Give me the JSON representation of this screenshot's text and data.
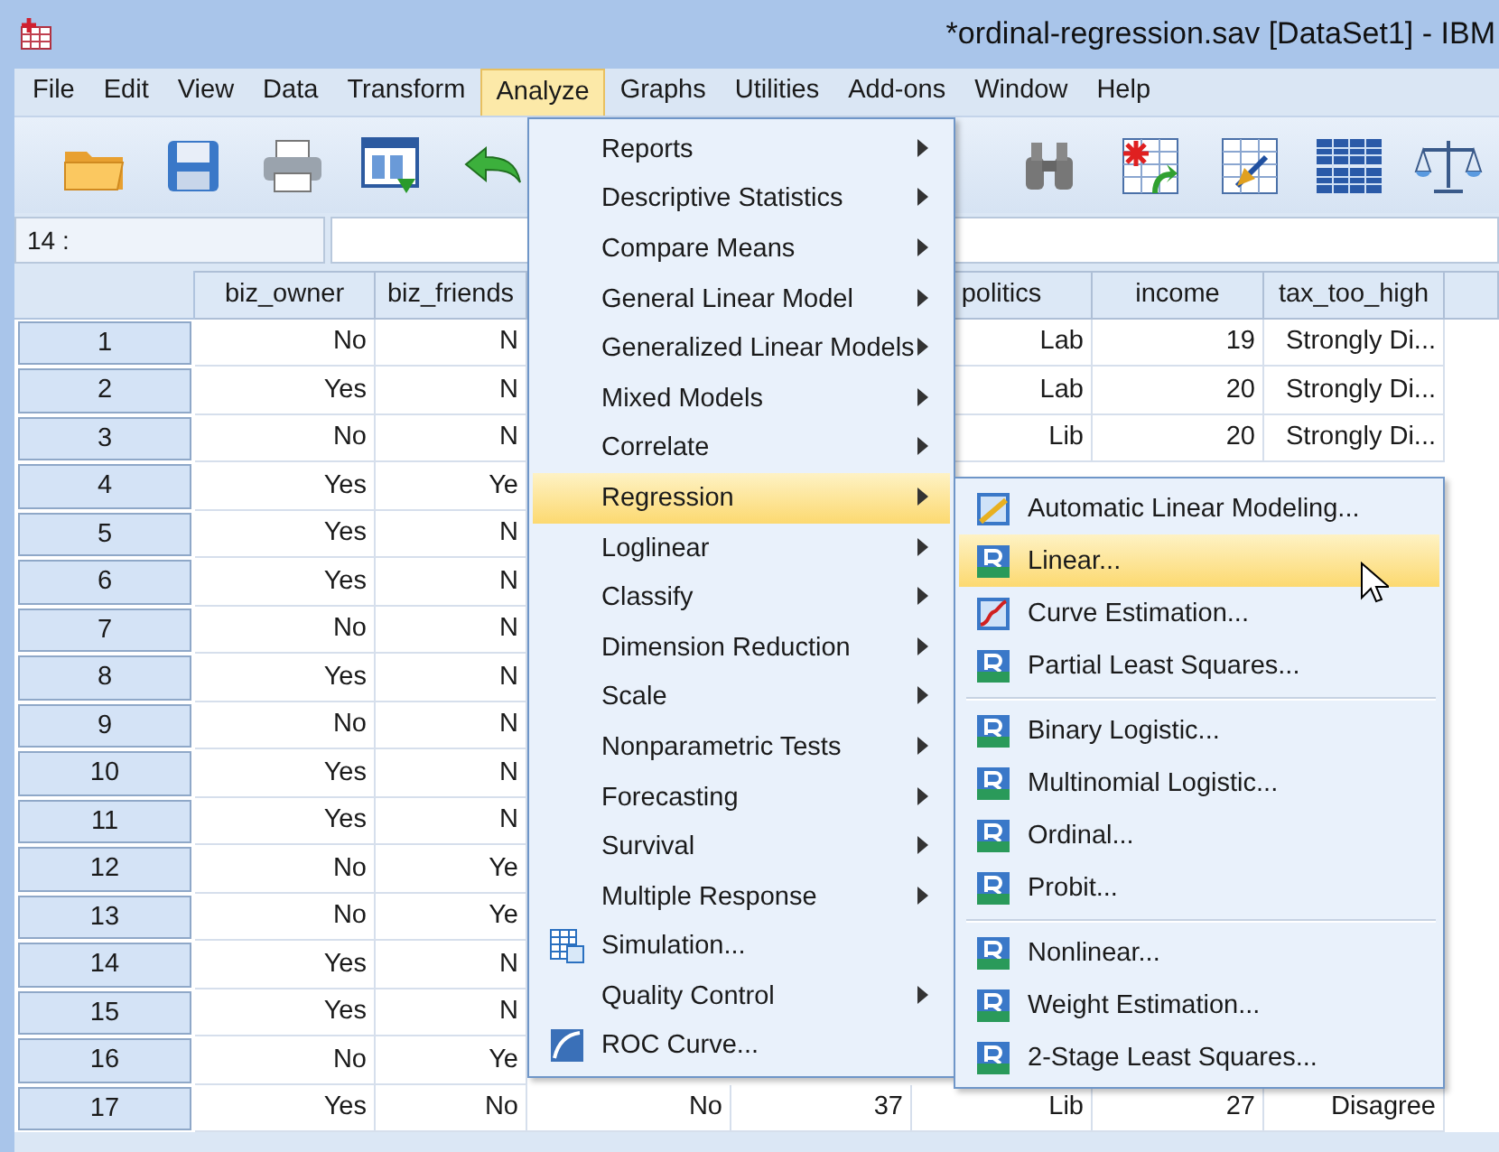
{
  "window": {
    "title": "*ordinal-regression.sav [DataSet1] - IBM"
  },
  "menu_bar": [
    {
      "label": "File",
      "selected": false
    },
    {
      "label": "Edit",
      "selected": false
    },
    {
      "label": "View",
      "selected": false
    },
    {
      "label": "Data",
      "selected": false
    },
    {
      "label": "Transform",
      "selected": false
    },
    {
      "label": "Analyze",
      "selected": true
    },
    {
      "label": "Graphs",
      "selected": false
    },
    {
      "label": "Utilities",
      "selected": false
    },
    {
      "label": "Add-ons",
      "selected": false
    },
    {
      "label": "Window",
      "selected": false
    },
    {
      "label": "Help",
      "selected": false
    }
  ],
  "toolbar": [
    {
      "kind": "folder"
    },
    {
      "kind": "save"
    },
    {
      "kind": "print"
    },
    {
      "kind": "recall"
    },
    {
      "kind": "undo"
    },
    {
      "kind": "gap"
    },
    {
      "kind": "find"
    },
    {
      "kind": "cases"
    },
    {
      "kind": "variable"
    },
    {
      "kind": "split"
    },
    {
      "kind": "weight"
    }
  ],
  "cell_reference": {
    "name": "14 :"
  },
  "grid": {
    "columns": [
      "biz_owner",
      "biz_friends",
      null,
      null,
      "politics",
      "income",
      "tax_too_high",
      null
    ],
    "rows": [
      {
        "number": "1",
        "cells": [
          "No",
          "N",
          null,
          null,
          "Lab",
          "19",
          "Strongly Di...",
          null
        ]
      },
      {
        "number": "2",
        "cells": [
          "Yes",
          "N",
          null,
          null,
          "Lab",
          "20",
          "Strongly Di...",
          null
        ]
      },
      {
        "number": "3",
        "cells": [
          "No",
          "N",
          null,
          null,
          "Lib",
          "20",
          "Strongly Di...",
          null
        ]
      },
      {
        "number": "4",
        "cells": [
          "Yes",
          "Ye",
          null,
          null,
          null,
          null,
          null,
          null
        ]
      },
      {
        "number": "5",
        "cells": [
          "Yes",
          "N",
          null,
          null,
          null,
          null,
          null,
          null
        ]
      },
      {
        "number": "6",
        "cells": [
          "Yes",
          "N",
          null,
          null,
          null,
          null,
          null,
          null
        ]
      },
      {
        "number": "7",
        "cells": [
          "No",
          "N",
          null,
          null,
          null,
          null,
          null,
          null
        ]
      },
      {
        "number": "8",
        "cells": [
          "Yes",
          "N",
          null,
          null,
          null,
          null,
          null,
          null
        ]
      },
      {
        "number": "9",
        "cells": [
          "No",
          "N",
          null,
          null,
          null,
          null,
          null,
          null
        ]
      },
      {
        "number": "10",
        "cells": [
          "Yes",
          "N",
          null,
          null,
          null,
          null,
          null,
          null
        ]
      },
      {
        "number": "11",
        "cells": [
          "Yes",
          "N",
          null,
          null,
          null,
          null,
          null,
          null
        ]
      },
      {
        "number": "12",
        "cells": [
          "No",
          "Ye",
          null,
          null,
          null,
          null,
          null,
          null
        ]
      },
      {
        "number": "13",
        "cells": [
          "No",
          "Ye",
          null,
          null,
          null,
          null,
          null,
          null
        ]
      },
      {
        "number": "14",
        "cells": [
          "Yes",
          "N",
          null,
          null,
          null,
          null,
          null,
          null
        ]
      },
      {
        "number": "15",
        "cells": [
          "Yes",
          "N",
          null,
          null,
          null,
          null,
          null,
          null
        ]
      },
      {
        "number": "16",
        "cells": [
          "No",
          "Ye",
          null,
          null,
          null,
          null,
          null,
          null
        ]
      },
      {
        "number": "17",
        "cells": [
          "Yes",
          "No",
          "No",
          "37",
          "Lib",
          "27",
          "Disagree",
          null
        ]
      }
    ]
  },
  "analyze_menu": {
    "items": [
      {
        "label": "Reports",
        "kind": "submenu",
        "selected": false
      },
      {
        "label": "Descriptive Statistics",
        "kind": "submenu",
        "selected": false
      },
      {
        "label": "Compare Means",
        "kind": "submenu",
        "selected": false
      },
      {
        "label": "General Linear Model",
        "kind": "submenu",
        "selected": false
      },
      {
        "label": "Generalized Linear Models",
        "kind": "submenu",
        "selected": false
      },
      {
        "label": "Mixed Models",
        "kind": "submenu",
        "selected": false
      },
      {
        "label": "Correlate",
        "kind": "submenu",
        "selected": false
      },
      {
        "label": "Regression",
        "kind": "submenu",
        "selected": true
      },
      {
        "label": "Loglinear",
        "kind": "submenu",
        "selected": false
      },
      {
        "label": "Classify",
        "kind": "submenu",
        "selected": false
      },
      {
        "label": "Dimension Reduction",
        "kind": "submenu",
        "selected": false
      },
      {
        "label": "Scale",
        "kind": "submenu",
        "selected": false
      },
      {
        "label": "Nonparametric Tests",
        "kind": "submenu",
        "selected": false
      },
      {
        "label": "Forecasting",
        "kind": "submenu",
        "selected": false
      },
      {
        "label": "Survival",
        "kind": "submenu",
        "selected": false
      },
      {
        "label": "Multiple Response",
        "kind": "submenu",
        "selected": false
      },
      {
        "label": "Simulation...",
        "kind": "simulation",
        "selected": false
      },
      {
        "label": "Quality Control",
        "kind": "submenu",
        "selected": false
      },
      {
        "label": "ROC Curve...",
        "kind": "roc",
        "selected": false
      }
    ]
  },
  "regression_submenu": {
    "groups": [
      [
        {
          "label": "Automatic Linear Modeling...",
          "kind": "diagonal",
          "selected": false
        },
        {
          "label": "Linear...",
          "kind": "tile",
          "selected": true
        },
        {
          "label": "Curve Estimation...",
          "kind": "curve",
          "selected": false
        },
        {
          "label": "Partial Least Squares...",
          "kind": "tile",
          "selected": false
        }
      ],
      [
        {
          "label": "Binary Logistic...",
          "kind": "tile",
          "selected": false
        },
        {
          "label": "Multinomial Logistic...",
          "kind": "tile",
          "selected": false
        },
        {
          "label": "Ordinal...",
          "kind": "tile",
          "selected": false
        },
        {
          "label": "Probit...",
          "kind": "tile",
          "selected": false
        }
      ],
      [
        {
          "label": "Nonlinear...",
          "kind": "tile",
          "selected": false
        },
        {
          "label": "Weight Estimation...",
          "kind": "tile",
          "selected": false
        },
        {
          "label": "2-Stage Least Squares...",
          "kind": "tile",
          "selected": false
        }
      ]
    ]
  }
}
